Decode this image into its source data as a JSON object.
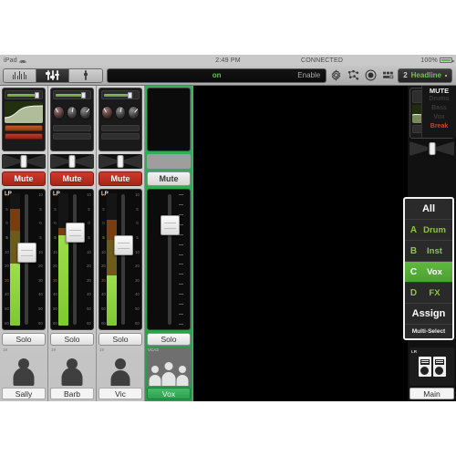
{
  "statusbar": {
    "device": "iPad",
    "wifi_icon": "wifi-icon",
    "time": "2:49 PM",
    "connection": "CONNECTED",
    "battery_pct": "100%",
    "battery_icon": "battery-icon"
  },
  "toolbar": {
    "view_meters_icon": "meters-view-icon",
    "view_mixer_icon": "mixer-view-icon",
    "view_channel_icon": "channel-view-icon",
    "main_bar_state": "on",
    "enable_label": "Enable",
    "settings_icon": "gear-icon",
    "network_icon": "network-nodes-icon",
    "record_icon": "record-circle-icon",
    "snapshots_icon": "snapshots-grid-icon",
    "preset_number": "2",
    "preset_name": "Headline",
    "preset_modified_dot": "modified-dot-icon"
  },
  "mute_groups": {
    "title": "MUTE",
    "items": [
      {
        "label": "Drums",
        "active": false
      },
      {
        "label": "Bass",
        "active": false
      },
      {
        "label": "Vox",
        "active": false
      },
      {
        "label": "Break",
        "active": true
      }
    ]
  },
  "group_panel": {
    "all_label": "All",
    "groups": [
      {
        "letter": "A",
        "name": "Drum",
        "selected": false
      },
      {
        "letter": "B",
        "name": "Inst",
        "selected": false
      },
      {
        "letter": "C",
        "name": "Vox",
        "selected": true
      },
      {
        "letter": "D",
        "name": "FX",
        "selected": false
      }
    ],
    "assign_label": "Assign",
    "multiselect_label": "Multi-Select"
  },
  "channels": [
    {
      "number": "18",
      "name": "Sally",
      "mute_label": "Mute",
      "mute_active": true,
      "solo_label": "Solo",
      "bus_label": "LR",
      "selected": false,
      "has_eq_graph": true,
      "avatar": "female-silhouette-icon"
    },
    {
      "number": "19",
      "name": "Barb",
      "mute_label": "Mute",
      "mute_active": true,
      "solo_label": "Solo",
      "bus_label": "LR",
      "selected": false,
      "has_eq_graph": false,
      "avatar": "female-silhouette-icon"
    },
    {
      "number": "19",
      "name": "Vic",
      "mute_label": "Mute",
      "mute_active": true,
      "solo_label": "Solo",
      "bus_label": "LR",
      "selected": false,
      "has_eq_graph": false,
      "avatar": "male-silhouette-icon"
    },
    {
      "number": "VCA3",
      "name": "Vox",
      "mute_label": "Mute",
      "mute_active": false,
      "solo_label": "Solo",
      "bus_label": "",
      "selected": true,
      "has_eq_graph": false,
      "avatar": "group-silhouette-icon"
    }
  ],
  "master": {
    "bus_label": "LR",
    "name": "Main",
    "speaker_icon": "speaker-pair-icon"
  },
  "fader_scale": {
    "left": [
      "10",
      "5",
      "0",
      "5",
      "10",
      "20",
      "30",
      "40",
      "50",
      "60"
    ],
    "right": [
      "10",
      "5",
      "0",
      "5",
      "10",
      "20",
      "30",
      "40",
      "50",
      "60"
    ]
  },
  "colors": {
    "accent_green": "#5fb83f",
    "select_green": "#34b05a",
    "mute_red": "#d03a2c",
    "meter_green": "#9ede4a",
    "panel_dark": "#1a1a1a"
  }
}
